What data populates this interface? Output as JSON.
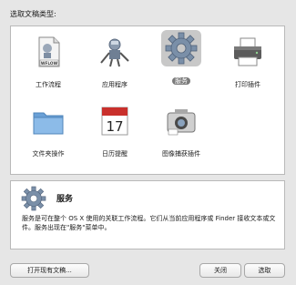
{
  "prompt": "选取文稿类型:",
  "items": [
    {
      "label": "工作流程",
      "icon": "workflow-document-icon",
      "badge": "WFLOW"
    },
    {
      "label": "应用程序",
      "icon": "application-robot-icon"
    },
    {
      "label": "服务",
      "icon": "gear-icon"
    },
    {
      "label": "打印插件",
      "icon": "printer-icon"
    },
    {
      "label": "文件夹操作",
      "icon": "folder-icon"
    },
    {
      "label": "日历提醒",
      "icon": "calendar-icon",
      "day": "17"
    },
    {
      "label": "图像捕获插件",
      "icon": "camera-icon"
    }
  ],
  "description": {
    "title": "服务",
    "text": "服务是可在整个 OS X 使用的关联工作流程。它们从当前应用程序或 Finder 接收文本或文件。服务出现在\"服务\"菜单中。"
  },
  "buttons": {
    "open_existing": "打开现有文稿...",
    "close": "关闭",
    "choose": "选取"
  }
}
